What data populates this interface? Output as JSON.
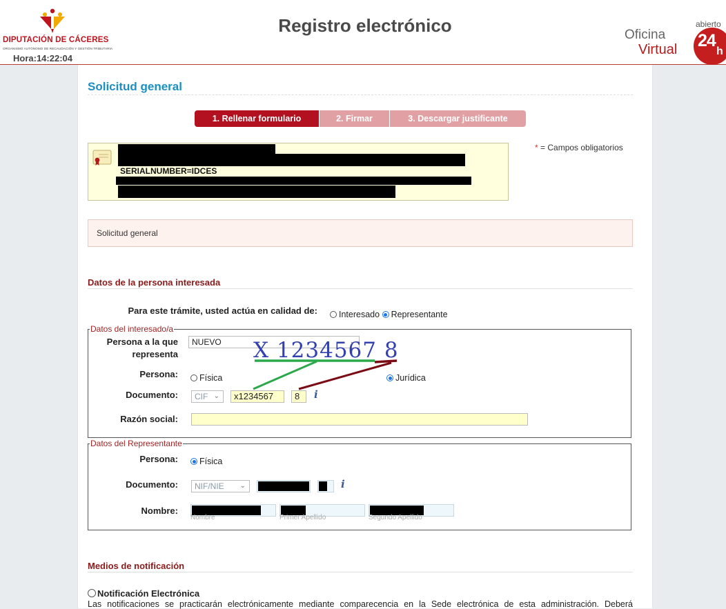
{
  "header": {
    "logo_name": "DIPUTACIÓN DE CÁCERES",
    "logo_sub": "ORGANISMO AUTÓNOMO DE RECAUDACIÓN Y GESTIÓN TRIBUTARIA",
    "hora_label": "Hora:",
    "hora_value": "14:22:04",
    "site_title": "Registro electrónico",
    "brand_word1": "Oficina",
    "brand_word2": "Virtual",
    "brand_abierto": "abierto",
    "brand_badge": "24",
    "brand_badge_h": "h"
  },
  "page": {
    "title": "Solicitud general",
    "steps": [
      "1. Rellenar formulario",
      "2. Firmar",
      "3. Descargar justificante"
    ],
    "active_step": 0,
    "certificate_serial": "SERIALNUMBER=IDCES",
    "mandatory_star": "*",
    "mandatory_text": "= Campos obligatorios",
    "solicitud_box": "Solicitud general"
  },
  "interesada": {
    "section_title": "Datos de la persona interesada",
    "calidad_label": "Para este trámite, usted actúa en calidad de:",
    "opt_interesado": "Interesado",
    "opt_representante": "Representante",
    "fieldset_legend": "Datos del interesado/a",
    "persona_repr_label": "Persona a la que representa",
    "persona_repr_value": "NUEVO",
    "persona_label": "Persona:",
    "opt_fisica": "Física",
    "opt_juridica": "Jurídica",
    "documento_label": "Documento:",
    "doc_type": "CIF",
    "doc_number": "x1234567",
    "doc_check": "8",
    "razon_label": "Razón social:",
    "razon_value": ""
  },
  "annotation": {
    "text": "X  1234567 8",
    "color_green": "#2aa84a",
    "color_red": "#7a0a14"
  },
  "representante": {
    "fieldset_legend": "Datos del Representante",
    "persona_label": "Persona:",
    "opt_fisica": "Física",
    "documento_label": "Documento:",
    "doc_type": "NIF/NIE",
    "nombre_label": "Nombre:",
    "hint_nombre": "Nombre",
    "hint_apellido1": "Primer Apellido",
    "hint_apellido2": "Segundo Apellido"
  },
  "notificacion": {
    "section_title": "Medios de notificación",
    "opt_electronica": "Notificación Electrónica",
    "desc": "Las notificaciones se practicarán electrónicamente mediante comparecencia en la Sede electrónica de esta administración. Deberá"
  },
  "colors": {
    "accent_blue": "#1b8fc4",
    "brand_red": "#b31020",
    "section_red": "#8b1a1a"
  }
}
